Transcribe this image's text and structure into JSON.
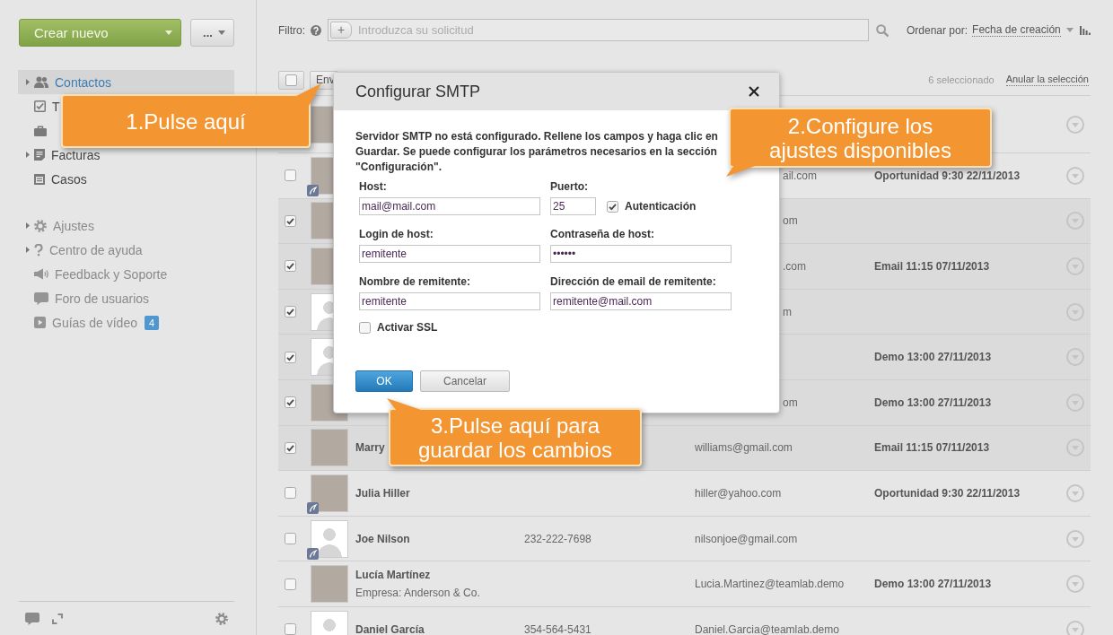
{
  "sidebar": {
    "create_button": "Crear nuevo",
    "more_button": "...",
    "sections": [
      {
        "items": [
          {
            "label": "Contactos",
            "expandable": true,
            "selected": true
          },
          {
            "label": "T",
            "expandable": false,
            "selected": false
          },
          {
            "expandable": false,
            "selected": false
          },
          {
            "label": "Facturas",
            "expandable": true,
            "selected": false
          },
          {
            "label": "Casos",
            "expandable": false,
            "selected": false
          }
        ]
      },
      {
        "items": [
          {
            "label": "Ajustes",
            "expandable": true,
            "selected": false
          },
          {
            "label": "Centro de ayuda",
            "expandable": true,
            "selected": false
          },
          {
            "label": "Feedback y Soporte",
            "expandable": false,
            "selected": false
          },
          {
            "label": "Foro de usuarios",
            "expandable": false,
            "selected": false
          },
          {
            "label": "Guías de vídeo",
            "expandable": false,
            "selected": false,
            "badge": "4"
          }
        ]
      }
    ]
  },
  "filter_bar": {
    "label": "Filtro:",
    "add_button": "+",
    "placeholder": "Introduzca su solicitud",
    "sort_label": "Ordenar por:",
    "sort_value": "Fecha de creación"
  },
  "list_header": {
    "select_all": {
      "checked": false
    },
    "buttons": [
      "Env"
    ],
    "selection_count": "6 seleccionado",
    "clear_selection": "Anular la selección"
  },
  "rows": [
    {
      "avatar": {
        "kind": "photo",
        "badge": false
      }
    },
    {
      "selected": false,
      "avatar": {
        "kind": "photo",
        "badge": true
      },
      "email": "ail.com",
      "activity": "Oportunidad 9:30 22/11/2013"
    },
    {
      "selected": true,
      "avatar": {
        "kind": "photo",
        "badge": false
      },
      "email": "om"
    },
    {
      "selected": true,
      "avatar": {
        "kind": "photo",
        "badge": false
      },
      "email": ".com",
      "activity": "Email 11:15 07/11/2013"
    },
    {
      "selected": true,
      "avatar": {
        "kind": "silhouette",
        "badge": false
      },
      "email": "m"
    },
    {
      "selected": true,
      "avatar": {
        "kind": "silhouette",
        "badge": false
      },
      "activity": "Demo 13:00 27/11/2013"
    },
    {
      "selected": true,
      "avatar": {
        "kind": "photo",
        "badge": false
      },
      "email": "om",
      "activity": "Demo 13:00 27/11/2013"
    },
    {
      "selected": true,
      "avatar": {
        "kind": "photo",
        "badge": false
      },
      "name": "Marry",
      "email": "williams@gmail.com",
      "activity": "Email 11:15 07/11/2013"
    },
    {
      "selected": false,
      "avatar": {
        "kind": "photo",
        "badge": true
      },
      "name": "Julia Hiller",
      "email": "hiller@yahoo.com",
      "activity": "Oportunidad 9:30 22/11/2013"
    },
    {
      "selected": false,
      "avatar": {
        "kind": "silhouette",
        "badge": true
      },
      "name": "Joe Nilson",
      "phone": "232-222-7698",
      "email": "nilsonjoe@gmail.com"
    },
    {
      "selected": false,
      "avatar": {
        "kind": "photo",
        "badge": false
      },
      "name": "Lucía Martínez",
      "company": "Empresa: Anderson & Co.",
      "email": "Lucia.Martinez@teamlab.demo",
      "activity": "Demo 13:00 27/11/2013"
    },
    {
      "selected": false,
      "avatar": {
        "kind": "silhouette",
        "badge": false
      },
      "name": "Daniel García",
      "phone": "354-564-5431",
      "email": "Daniel.Garcia@teamlab.demo"
    }
  ],
  "dialog": {
    "title": "Configurar SMTP",
    "message": "Servidor SMTP no está configurado. Rellene los campos y haga clic en Guardar. Se puede configurar los parámetros necesarios en la sección \"Configuración\".",
    "fields": [
      {
        "kind": "text",
        "label": "Host:",
        "value": "mail@mail.com"
      },
      {
        "kind": "port",
        "label": "Puerto:",
        "value": "25",
        "option": {
          "label": "Autenticación",
          "checked": true
        }
      },
      {
        "kind": "text",
        "label": "Login de host:",
        "value": "remitente"
      },
      {
        "kind": "text",
        "label": "Contraseña de host:",
        "value": "••••••"
      },
      {
        "kind": "text",
        "label": "Nombre de remitente:",
        "value": "remitente"
      },
      {
        "kind": "text",
        "label": "Dirección de email de remitente:",
        "value": "remitente@mail.com"
      }
    ],
    "ssl": {
      "label": "Activar SSL",
      "checked": false
    },
    "buttons": [
      {
        "kind": "primary",
        "label": "OK"
      },
      {
        "kind": "secondary",
        "label": "Cancelar"
      }
    ]
  },
  "callouts": [
    {
      "text": "1.Pulse aquí"
    },
    {
      "text": "2.Configure los ajustes disponibles"
    },
    {
      "text": "3.Pulse aquí para guardar los cambios"
    }
  ]
}
